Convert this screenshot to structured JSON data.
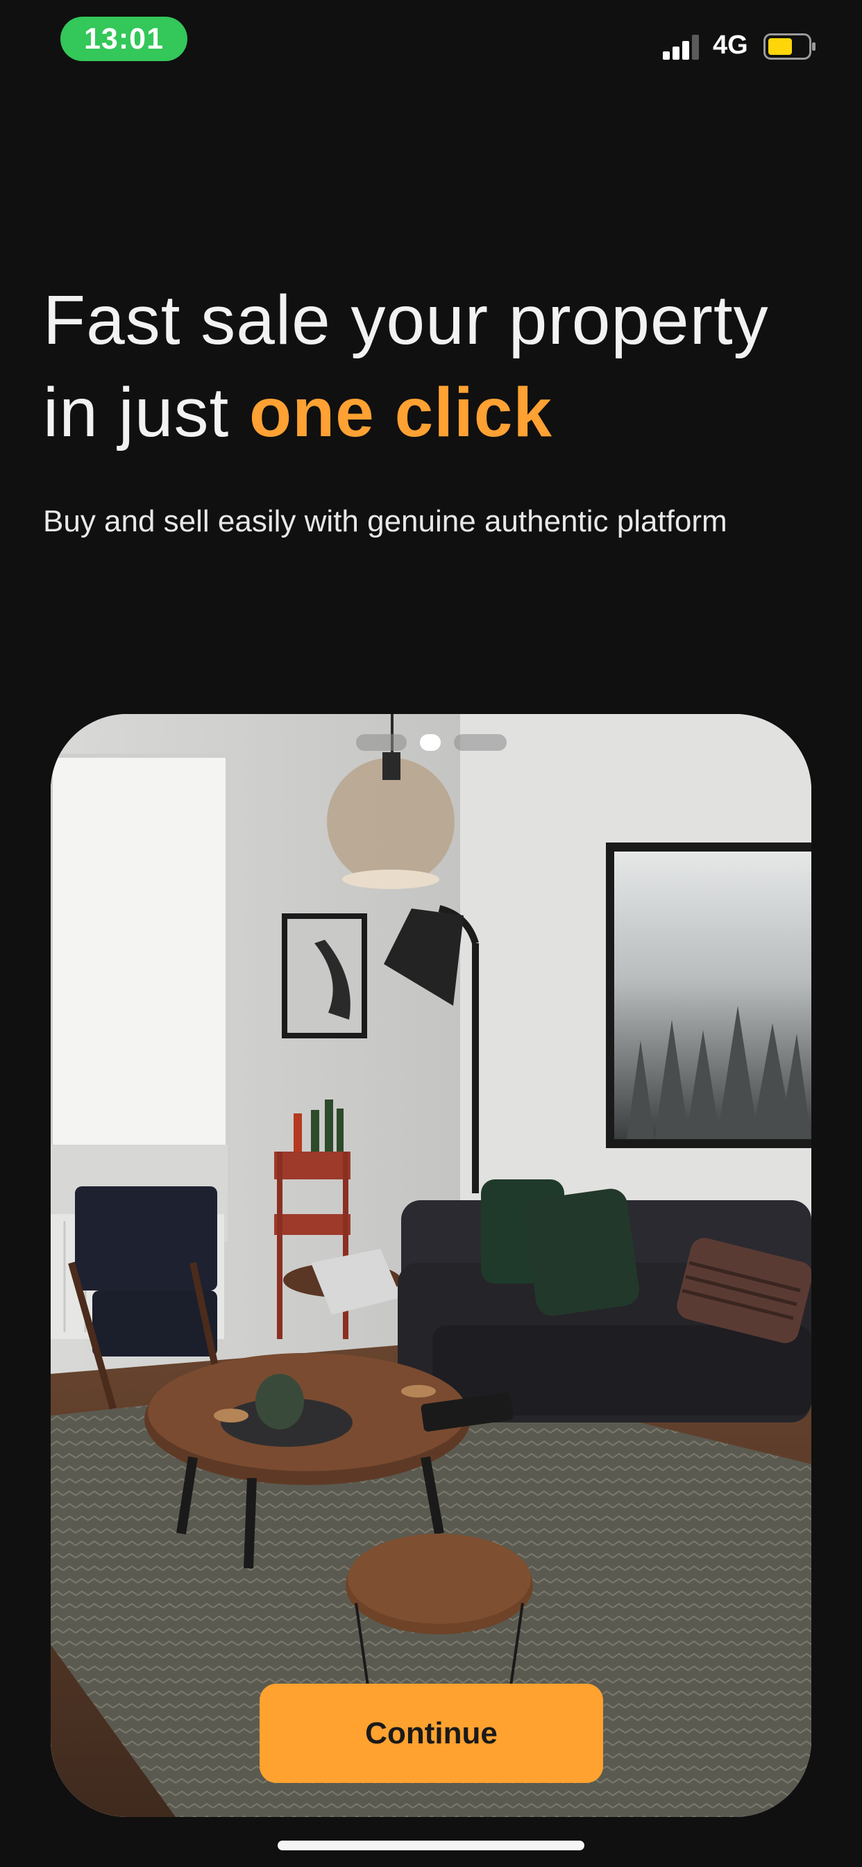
{
  "status_bar": {
    "time": "13:01",
    "network": "4G",
    "icons": [
      "signal-icon",
      "battery-icon"
    ],
    "battery_color": "#ffd60a"
  },
  "hero": {
    "title_line1": "Fast sale your property",
    "title_line2_prefix": "in just ",
    "title_line2_accent": "one click",
    "subtitle": "Buy and sell easily with genuine authentic platform"
  },
  "carousel": {
    "page_count": 3,
    "active_index": 1,
    "image": "living-room-photo"
  },
  "actions": {
    "continue_label": "Continue"
  },
  "colors": {
    "background": "#101010",
    "accent": "#ffa133",
    "button": "#ffa230",
    "status_green": "#34c759"
  }
}
